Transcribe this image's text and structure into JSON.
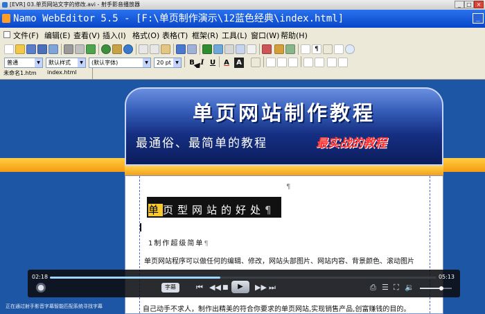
{
  "player_title": "[EVR] 03.单页网站文字的修改.avi - 射手影音播放器",
  "editor_title": "Namo WebEditor 5.5 - [F:\\单页制作演示\\12蓝色经典\\index.html]",
  "menu": [
    "文件(F)",
    "编辑(E)",
    "查看(V)",
    "插入(I)",
    "格式(O)",
    "表格(T)",
    "框架(R)",
    "工具(L)",
    "窗口(W)",
    "帮助(H)"
  ],
  "format_bar": {
    "style_select": "普通",
    "preset_select": "默认样式",
    "font_select": "(默认字体)",
    "size_select": "20 pt",
    "bold": "B",
    "italic": "I",
    "underline": "U",
    "text_color": "A",
    "highlight": "A"
  },
  "tabs": [
    "未命名1.htm",
    "index.html"
  ],
  "page": {
    "banner_title": "单页网站制作教程",
    "banner_subtitle": "最通俗、最简单的教程",
    "banner_badge": "最实战的教程",
    "heading_selected": "单",
    "heading_rest": "页型网站的好处",
    "pilcrow": "¶",
    "sub_heading": "1制作超级简单",
    "paragraph_1": "单页网站程序可以做任何的编辑、修改，网站头部图片、网站内容、背景颜色、滚动图片",
    "paragraph_last": "自己动手不求人，制作出精美的符合你要求的单页网站,实现销售产品,创富赚钱的目的。"
  },
  "player": {
    "time_current": "02:18",
    "time_total": "05:13",
    "progress": 0.44,
    "volume": 0.68,
    "subtitle_button": "字幕"
  },
  "status_text": "正在通过射手影音字幕智能匹配系统寻找字幕",
  "icons": [
    "player-logo-icon",
    "minimize-icon",
    "maximize-icon",
    "close-icon",
    "namo-logo-icon",
    "prev-icon",
    "play-icon",
    "next-icon",
    "stop-icon",
    "playlist-icon",
    "volume-icon",
    "fullscreen-icon"
  ]
}
